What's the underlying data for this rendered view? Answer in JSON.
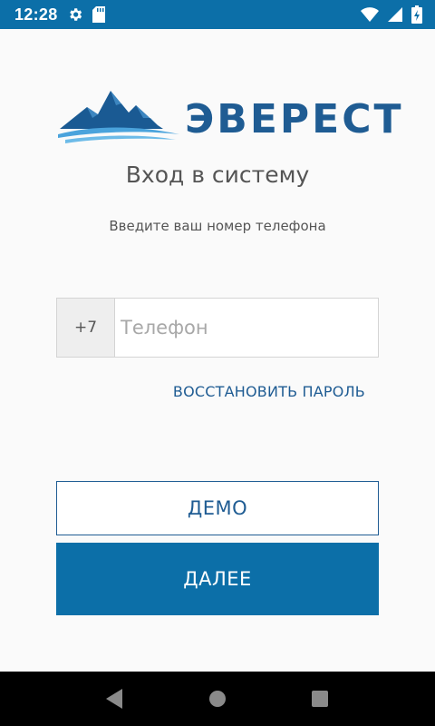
{
  "status_bar": {
    "time": "12:28",
    "icons": [
      "settings-icon",
      "sd-card-icon",
      "wifi-icon",
      "signal-icon",
      "battery-icon"
    ]
  },
  "logo": {
    "text": "ЭВЕРЕСТ",
    "icon": "mountain-logo-icon"
  },
  "login": {
    "title": "Вход в систему",
    "subtitle": "Введите ваш номер телефона",
    "phone_prefix": "+7",
    "phone_placeholder": "Телефон",
    "phone_value": "",
    "restore_password": "ВОССТАНОВИТЬ ПАРОЛЬ",
    "demo_button": "ДЕМО",
    "next_button": "ДАЛЕЕ"
  },
  "navigation": {
    "icons": [
      "back-icon",
      "home-icon",
      "recents-icon"
    ]
  },
  "colors": {
    "primary": "#0c6fa8",
    "brand_text": "#1f5c93",
    "background": "#fafafa"
  }
}
